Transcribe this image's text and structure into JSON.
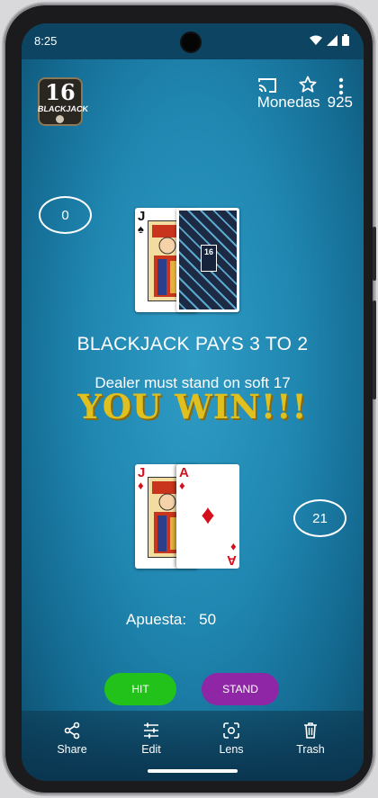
{
  "status": {
    "time": "8:25"
  },
  "app": {
    "logo_number": "16",
    "logo_word": "BLACKJACK"
  },
  "header": {
    "coins_label": "Monedas",
    "coins_value": "925"
  },
  "dealer": {
    "score": "0",
    "cards": [
      {
        "rank": "J",
        "suit": "♠",
        "color": "#111111"
      },
      {
        "face_down": true,
        "badge": "16"
      }
    ]
  },
  "table": {
    "pays_text": "BLACKJACK PAYS 3 TO 2",
    "dealer_rule": "Dealer must stand on soft 17",
    "result_text": "YOU WIN!!!"
  },
  "player": {
    "score": "21",
    "cards": [
      {
        "rank": "J",
        "suit": "♦",
        "color": "#d4101c"
      },
      {
        "rank": "A",
        "suit": "♦",
        "color": "#d4101c"
      }
    ]
  },
  "bet": {
    "label": "Apuesta:",
    "value": "50"
  },
  "actions": {
    "hit": "HIT",
    "stand": "STAND"
  },
  "bottom_bar": [
    {
      "label": "Share",
      "icon": "share-icon"
    },
    {
      "label": "Edit",
      "icon": "edit-icon"
    },
    {
      "label": "Lens",
      "icon": "lens-icon"
    },
    {
      "label": "Trash",
      "icon": "trash-icon"
    }
  ],
  "colors": {
    "hit": "#22c21b",
    "stand": "#8e26a5",
    "win": "#e0c01e",
    "felt": "#1f86b0"
  }
}
